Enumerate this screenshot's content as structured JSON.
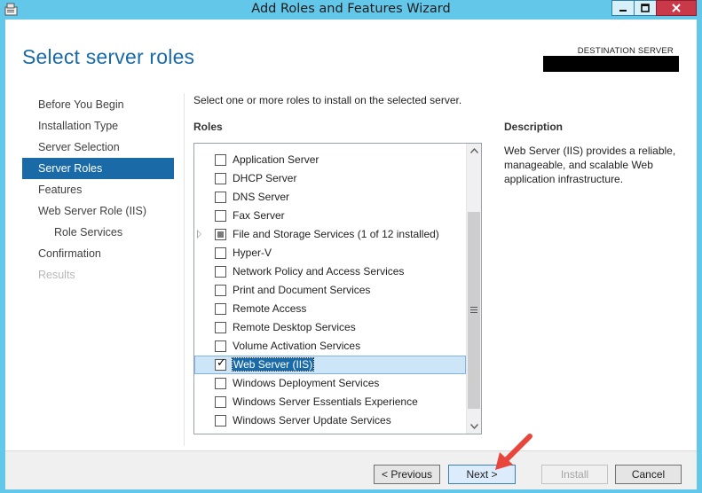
{
  "window": {
    "title": "Add Roles and Features Wizard",
    "controls": {
      "minimize": "minimize",
      "maximize": "maximize",
      "close": "close"
    }
  },
  "page": {
    "title": "Select server roles"
  },
  "destination": {
    "label": "DESTINATION SERVER",
    "value_redacted": true
  },
  "nav": {
    "items": [
      {
        "label": "Before You Begin",
        "state": "normal",
        "indent": 0
      },
      {
        "label": "Installation Type",
        "state": "normal",
        "indent": 0
      },
      {
        "label": "Server Selection",
        "state": "normal",
        "indent": 0
      },
      {
        "label": "Server Roles",
        "state": "active",
        "indent": 0
      },
      {
        "label": "Features",
        "state": "normal",
        "indent": 0
      },
      {
        "label": "Web Server Role (IIS)",
        "state": "normal",
        "indent": 0
      },
      {
        "label": "Role Services",
        "state": "normal",
        "indent": 1
      },
      {
        "label": "Confirmation",
        "state": "normal",
        "indent": 0
      },
      {
        "label": "Results",
        "state": "disabled",
        "indent": 0
      }
    ]
  },
  "main": {
    "instruction": "Select one or more roles to install on the selected server.",
    "roles_header": "Roles",
    "description_header": "Description",
    "description_text": "Web Server (IIS) provides a reliable, manageable, and scalable Web application infrastructure."
  },
  "roles": [
    {
      "label": "Application Server",
      "state": "unchecked"
    },
    {
      "label": "DHCP Server",
      "state": "unchecked"
    },
    {
      "label": "DNS Server",
      "state": "unchecked"
    },
    {
      "label": "Fax Server",
      "state": "unchecked"
    },
    {
      "label": "File and Storage Services (1 of 12 installed)",
      "state": "partial",
      "expandable": true
    },
    {
      "label": "Hyper-V",
      "state": "unchecked"
    },
    {
      "label": "Network Policy and Access Services",
      "state": "unchecked"
    },
    {
      "label": "Print and Document Services",
      "state": "unchecked"
    },
    {
      "label": "Remote Access",
      "state": "unchecked"
    },
    {
      "label": "Remote Desktop Services",
      "state": "unchecked"
    },
    {
      "label": "Volume Activation Services",
      "state": "unchecked"
    },
    {
      "label": "Web Server (IIS)",
      "state": "checked",
      "selected": true
    },
    {
      "label": "Windows Deployment Services",
      "state": "unchecked"
    },
    {
      "label": "Windows Server Essentials Experience",
      "state": "unchecked"
    },
    {
      "label": "Windows Server Update Services",
      "state": "unchecked"
    }
  ],
  "buttons": {
    "previous": "< Previous",
    "next": "Next >",
    "install": "Install",
    "cancel": "Cancel"
  },
  "icons": {
    "check": "✓",
    "scroll_up": "chevron-up-icon",
    "scroll_down": "chevron-down-icon",
    "annotation": "red-arrow-icon"
  },
  "colors": {
    "frame": "#63c7ea",
    "accent": "#1a6aa8",
    "selection_bg": "#cde6f7",
    "annotation_arrow": "#e8463c"
  }
}
